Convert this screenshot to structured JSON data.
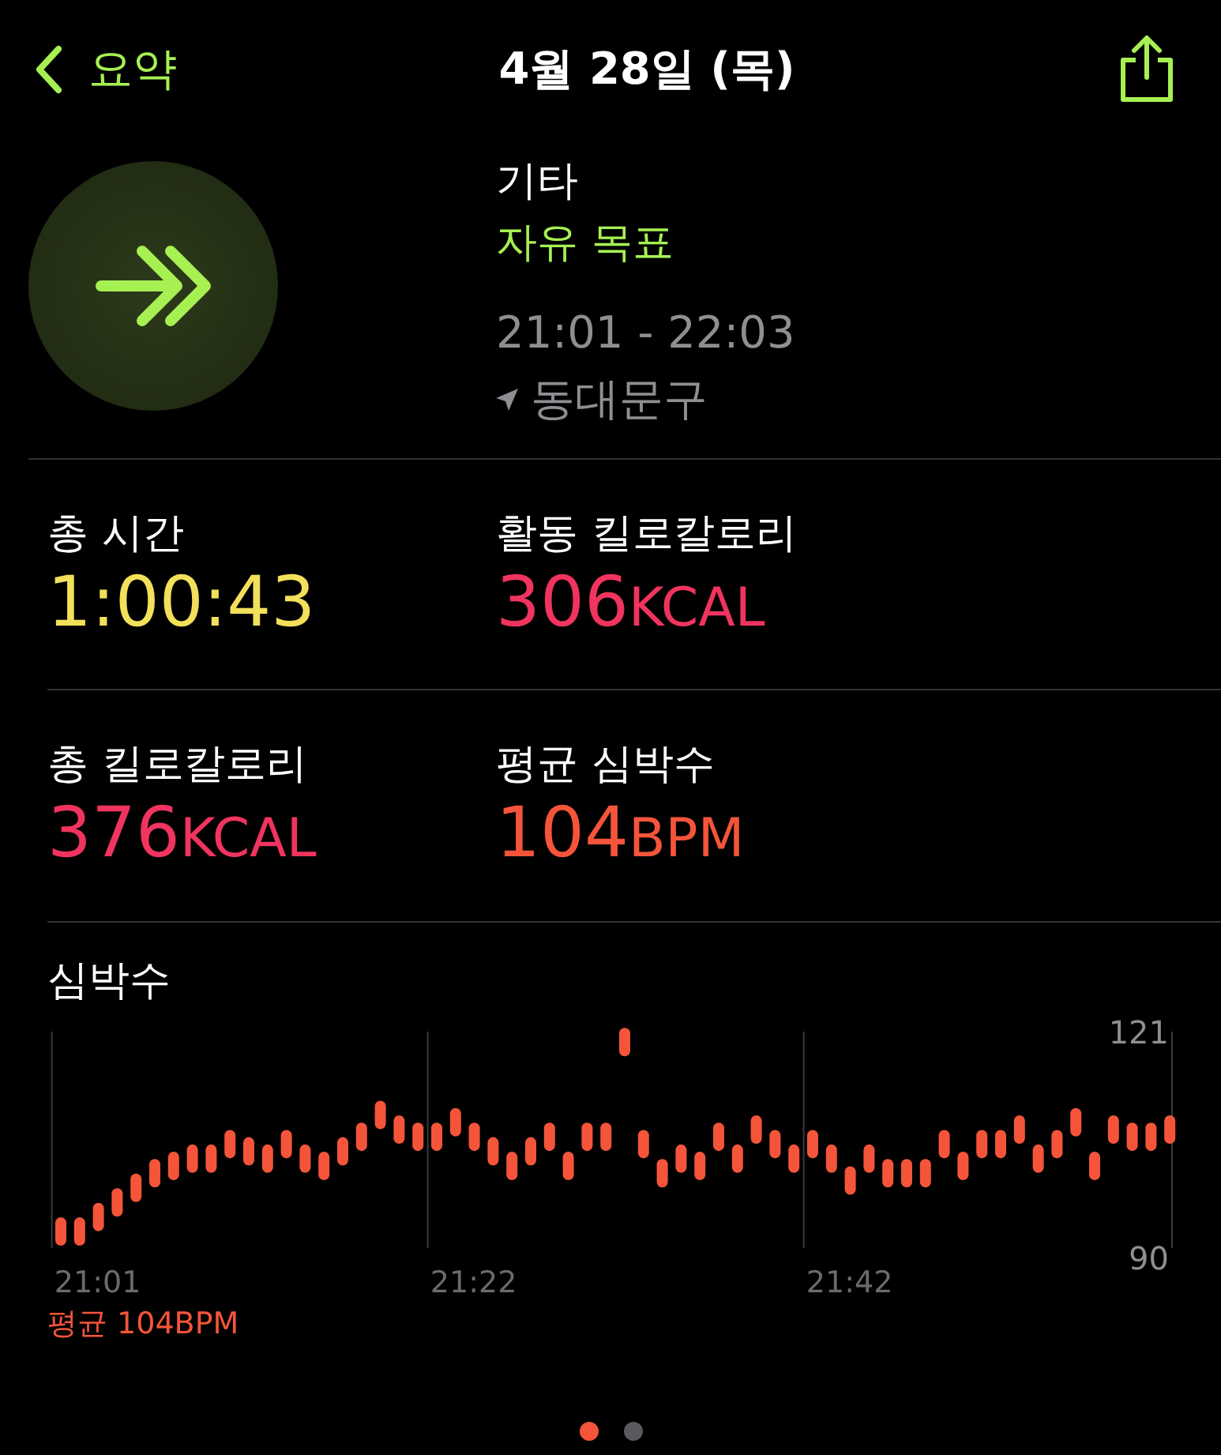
{
  "nav": {
    "back_label": "요약",
    "title": "4월 28일 (목)"
  },
  "workout": {
    "type": "기타",
    "goal": "자유 목표",
    "time_range": "21:01 - 22:03",
    "location": "동대문구"
  },
  "stats": [
    {
      "label": "총 시간",
      "value": "1:00:43",
      "color": "#f2e05a"
    },
    {
      "label": "활동 킬로칼로리",
      "value": "306",
      "unit": "KCAL",
      "color": "#f0345f"
    },
    {
      "label": "총 킬로칼로리",
      "value": "376",
      "unit": "KCAL",
      "color": "#f0345f"
    },
    {
      "label": "평균 심박수",
      "value": "104",
      "unit": "BPM",
      "color": "#f4553a"
    }
  ],
  "heart_rate": {
    "title": "심박수",
    "average": "평균 104BPM",
    "chart_data": {
      "type": "scatter",
      "categories": [
        null,
        null,
        "21:01",
        null,
        null,
        null,
        null,
        null,
        null,
        null,
        null,
        null,
        null,
        null,
        null,
        null,
        null,
        null,
        null,
        null,
        null,
        null,
        "21:22",
        null,
        null,
        null,
        null,
        null,
        null,
        null,
        null,
        null,
        null,
        null,
        null,
        null,
        null,
        null,
        null,
        null,
        null,
        null,
        "21:42",
        null,
        null,
        null,
        null,
        null,
        null,
        null,
        null,
        null,
        null,
        null,
        null,
        null,
        null,
        null,
        null,
        null
      ],
      "series": [
        {
          "color": "#f4553a",
          "values": [
            94,
            94,
            96,
            98,
            100,
            102,
            103,
            104,
            104,
            106,
            105,
            104,
            106,
            104,
            103,
            105,
            107,
            110,
            108,
            107,
            107,
            109,
            107,
            105,
            103,
            105,
            107,
            103,
            107,
            107,
            120,
            106,
            102,
            104,
            103,
            107,
            104,
            108,
            106,
            104,
            106,
            104,
            101,
            104,
            102,
            102,
            102,
            106,
            103,
            106,
            106,
            108,
            104,
            106,
            109,
            103,
            108,
            107,
            107,
            108
          ]
        }
      ],
      "ylim": [
        90,
        121
      ],
      "yticks": [
        90,
        121
      ]
    }
  },
  "pager": [
    {
      "selected": true
    },
    {
      "selected": false
    }
  ]
}
